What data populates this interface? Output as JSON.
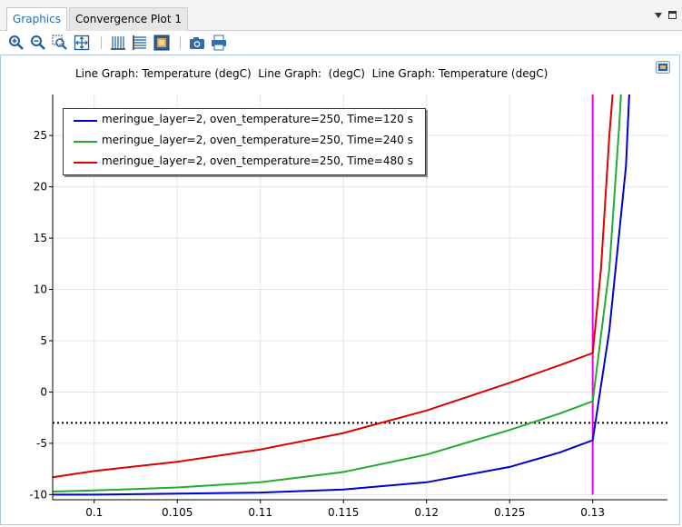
{
  "tabs": [
    {
      "label": "Graphics",
      "active": true
    },
    {
      "label": "Convergence Plot 1",
      "active": false
    }
  ],
  "toolbar": {
    "icons": [
      "zoom-in-icon",
      "zoom-out-icon",
      "zoom-box-icon",
      "zoom-extents-icon",
      "x-grid-icon",
      "y-grid-icon",
      "scene-light-icon",
      "camera-icon",
      "print-icon"
    ]
  },
  "plot": {
    "title": "Line Graph: Temperature (degC)  Line Graph:  (degC)  Line Graph: Temperature (degC)"
  },
  "chart_data": {
    "type": "line",
    "title": "Line Graph: Temperature (degC)  Line Graph:  (degC)  Line Graph: Temperature (degC)",
    "xlabel": "",
    "ylabel": "",
    "xlim": [
      0.0975,
      0.1345
    ],
    "ylim": [
      -10.5,
      29
    ],
    "xticks": [
      "0.1",
      "0.105",
      "0.11",
      "0.115",
      "0.12",
      "0.125",
      "0.13"
    ],
    "xtick_values": [
      0.1,
      0.105,
      0.11,
      0.115,
      0.12,
      0.125,
      0.13
    ],
    "yticks": [
      "-10",
      "-5",
      "0",
      "5",
      "10",
      "15",
      "20",
      "25"
    ],
    "ytick_values": [
      -10,
      -5,
      0,
      5,
      10,
      15,
      20,
      25
    ],
    "grid": true,
    "legend_position": "top-left",
    "series": [
      {
        "name": "meringue_layer=2, oven_temperature=250, Time=120 s",
        "color": "#0000cc",
        "x": [
          0.0975,
          0.1,
          0.105,
          0.11,
          0.115,
          0.12,
          0.125,
          0.128,
          0.13,
          0.131,
          0.132,
          0.1322
        ],
        "y": [
          -10.0,
          -10.0,
          -9.9,
          -9.8,
          -9.5,
          -8.8,
          -7.3,
          -5.9,
          -4.7,
          6.0,
          22.0,
          29.0
        ]
      },
      {
        "name": "meringue_layer=2, oven_temperature=250, Time=240 s",
        "color": "#22aa33",
        "x": [
          0.0975,
          0.1,
          0.105,
          0.11,
          0.115,
          0.12,
          0.125,
          0.128,
          0.13,
          0.131,
          0.1316,
          0.1317
        ],
        "y": [
          -9.7,
          -9.6,
          -9.3,
          -8.8,
          -7.8,
          -6.1,
          -3.7,
          -2.1,
          -0.9,
          12.0,
          26.0,
          29.0
        ]
      },
      {
        "name": "meringue_layer=2, oven_temperature=250, Time=480 s",
        "color": "#dd0000",
        "x": [
          0.0975,
          0.1,
          0.105,
          0.11,
          0.115,
          0.12,
          0.125,
          0.128,
          0.13,
          0.1305,
          0.131,
          0.1312
        ],
        "y": [
          -8.3,
          -7.7,
          -6.8,
          -5.6,
          -4.0,
          -1.8,
          0.9,
          2.6,
          3.8,
          12.0,
          25.0,
          29.0
        ]
      }
    ],
    "reference_lines": [
      {
        "orientation": "horizontal",
        "value": -3,
        "style": "dotted",
        "color": "#000000"
      },
      {
        "orientation": "vertical",
        "value": 0.13,
        "style": "solid",
        "color": "#ee00ee",
        "range": [
          -10,
          29
        ]
      }
    ]
  }
}
